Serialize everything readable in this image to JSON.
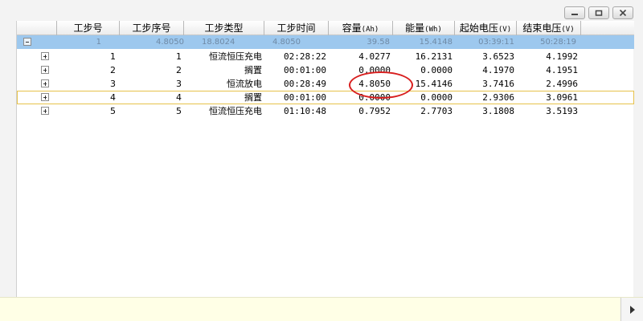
{
  "window_controls": {
    "minimize_icon": "minimize-icon",
    "restore_icon": "restore-icon",
    "close_icon": "close-icon"
  },
  "columns": [
    {
      "label": "工步号",
      "unit": ""
    },
    {
      "label": "工步序号",
      "unit": ""
    },
    {
      "label": "工步类型",
      "unit": ""
    },
    {
      "label": "工步时间",
      "unit": ""
    },
    {
      "label": "容量",
      "unit": "(Ah)"
    },
    {
      "label": "能量",
      "unit": "(Wh)"
    },
    {
      "label": "起始电压",
      "unit": "(V)"
    },
    {
      "label": "结束电压",
      "unit": "(V)"
    }
  ],
  "summary_row": {
    "c1": "1",
    "c2": "4.8050",
    "c3": "18.8024",
    "c4": "4.8050",
    "c5": "39.58",
    "c6": "15.4148",
    "c7": "03:39:11",
    "c8": "50:28:19"
  },
  "rows": [
    {
      "step_no": "1",
      "step_seq": "1",
      "type": "恒流恒压充电",
      "time": "02:28:22",
      "capacity": "4.0277",
      "energy": "16.2131",
      "v_start": "3.6523",
      "v_end": "4.1992"
    },
    {
      "step_no": "2",
      "step_seq": "2",
      "type": "搁置",
      "time": "00:01:00",
      "capacity": "0.0000",
      "energy": "0.0000",
      "v_start": "4.1970",
      "v_end": "4.1951"
    },
    {
      "step_no": "3",
      "step_seq": "3",
      "type": "恒流放电",
      "time": "00:28:49",
      "capacity": "4.8050",
      "energy": "15.4146",
      "v_start": "3.7416",
      "v_end": "2.4996"
    },
    {
      "step_no": "4",
      "step_seq": "4",
      "type": "搁置",
      "time": "00:01:00",
      "capacity": "0.0000",
      "energy": "0.0000",
      "v_start": "2.9306",
      "v_end": "3.0961"
    },
    {
      "step_no": "5",
      "step_seq": "5",
      "type": "恒流恒压充电",
      "time": "01:10:48",
      "capacity": "0.7952",
      "energy": "2.7703",
      "v_start": "3.1808",
      "v_end": "3.5193"
    }
  ],
  "highlight": {
    "row": 2,
    "field": "capacity",
    "color": "#d81e1e"
  },
  "colors": {
    "summary_bg": "#9dc8ee",
    "selected_border": "#e7c24a",
    "status_bg": "#ffffe6"
  }
}
